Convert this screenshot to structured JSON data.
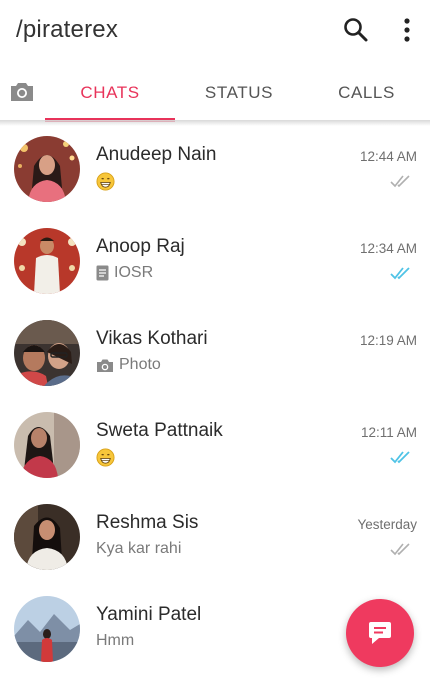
{
  "app": {
    "title": "/piraterex"
  },
  "icons": {
    "search": "search-icon",
    "more": "more-vert-icon",
    "camera": "camera-icon",
    "fab": "new-chat-icon"
  },
  "tabs": [
    {
      "label": "CHATS",
      "active": true
    },
    {
      "label": "STATUS",
      "active": false
    },
    {
      "label": "CALLS",
      "active": false
    }
  ],
  "colors": {
    "accent": "#e8335a",
    "fab": "#ef3a5f",
    "read_ticks": "#4fc3e6",
    "delivered_ticks": "#b0b0b0"
  },
  "chats": [
    {
      "name": "Anudeep Nain",
      "time": "12:44 AM",
      "preview": "",
      "preview_icon": "grinning-emoji-icon",
      "status": "delivered"
    },
    {
      "name": "Anoop Raj",
      "time": "12:34 AM",
      "preview": "IOSR",
      "preview_icon": "document-icon",
      "status": "read"
    },
    {
      "name": "Vikas Kothari",
      "time": "12:19 AM",
      "preview": "Photo",
      "preview_icon": "camera-icon",
      "status": "none"
    },
    {
      "name": "Sweta Pattnaik",
      "time": "12:11 AM",
      "preview": "",
      "preview_icon": "grinning-emoji-icon",
      "status": "read"
    },
    {
      "name": "Reshma Sis",
      "time": "Yesterday",
      "preview": "Kya kar rahi",
      "preview_icon": "",
      "status": "delivered"
    },
    {
      "name": "Yamini Patel",
      "time": "",
      "preview": "Hmm",
      "preview_icon": "",
      "status": "none"
    }
  ]
}
